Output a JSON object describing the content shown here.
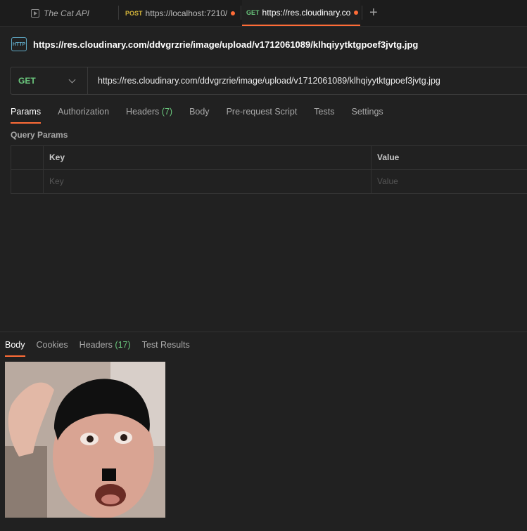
{
  "tabs": [
    {
      "method": "",
      "name": "The Cat API",
      "icon": "play-icon"
    },
    {
      "method": "POST",
      "name": "https://localhost:7210/",
      "unsaved": true
    },
    {
      "method": "GET",
      "name": "https://res.cloudinary.co",
      "unsaved": true,
      "active": true
    }
  ],
  "new_tab_label": "+",
  "request": {
    "icon_text": "HTTP",
    "title": "https://res.cloudinary.com/ddvgrzrie/image/upload/v1712061089/klhqiyytktgpoef3jvtg.jpg",
    "method": "GET",
    "url": "https://res.cloudinary.com/ddvgrzrie/image/upload/v1712061089/klhqiyytktgpoef3jvtg.jpg"
  },
  "subtabs": {
    "params": "Params",
    "authorization": "Authorization",
    "headers": "Headers",
    "headers_count": "(7)",
    "body": "Body",
    "prerequest": "Pre-request Script",
    "tests": "Tests",
    "settings": "Settings"
  },
  "query_params": {
    "label": "Query Params",
    "col_key": "Key",
    "col_value": "Value",
    "placeholder_key": "Key",
    "placeholder_value": "Value"
  },
  "response": {
    "tabs": {
      "body": "Body",
      "cookies": "Cookies",
      "headers": "Headers",
      "headers_count": "(17)",
      "test_results": "Test Results"
    },
    "preview": "image-preview"
  },
  "colors": {
    "accent": "#ff6c37",
    "get": "#6ac77d",
    "post": "#d1b23a",
    "background": "#212121"
  }
}
